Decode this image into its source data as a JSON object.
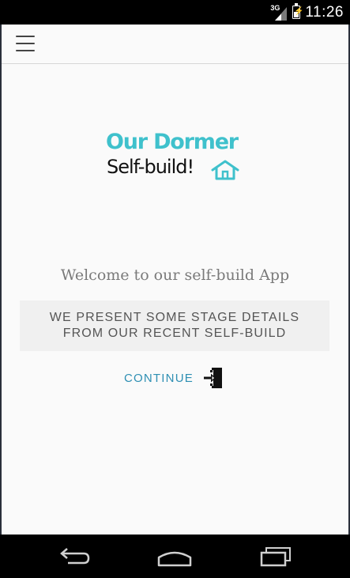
{
  "status_bar": {
    "network_type": "3G",
    "time": "11:26",
    "icons": [
      "signal-icon",
      "battery-charging-icon"
    ]
  },
  "toolbar": {
    "menu_icon": "hamburger-menu-icon"
  },
  "logo": {
    "line1": "Our Dormer",
    "line2": "Self-build!",
    "line1_color": "#3fc1cc",
    "line2_color": "#111111",
    "icon": "house-icon"
  },
  "main": {
    "welcome_text": "Welcome to our self-build App",
    "intro_text": "WE PRESENT SOME STAGE DETAILS FROM OUR RECENT SELF-BUILD",
    "continue_label": "CONTINUE",
    "continue_icon": "login-icon",
    "accent_color": "#2e8fb3"
  },
  "nav_bar": {
    "icons": [
      "back-icon",
      "home-icon",
      "recent-apps-icon"
    ]
  }
}
